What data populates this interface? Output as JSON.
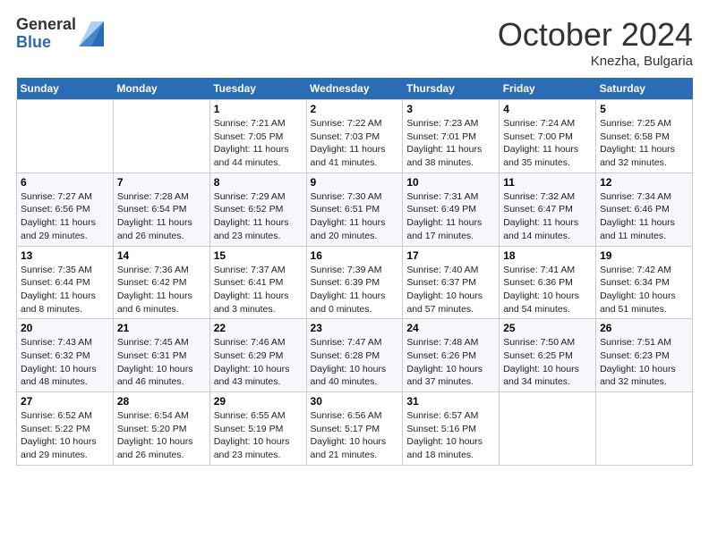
{
  "header": {
    "logo_general": "General",
    "logo_blue": "Blue",
    "month_title": "October 2024",
    "location": "Knezha, Bulgaria"
  },
  "weekdays": [
    "Sunday",
    "Monday",
    "Tuesday",
    "Wednesday",
    "Thursday",
    "Friday",
    "Saturday"
  ],
  "weeks": [
    [
      {
        "day": "",
        "sunrise": "",
        "sunset": "",
        "daylight": ""
      },
      {
        "day": "",
        "sunrise": "",
        "sunset": "",
        "daylight": ""
      },
      {
        "day": "1",
        "sunrise": "Sunrise: 7:21 AM",
        "sunset": "Sunset: 7:05 PM",
        "daylight": "Daylight: 11 hours and 44 minutes."
      },
      {
        "day": "2",
        "sunrise": "Sunrise: 7:22 AM",
        "sunset": "Sunset: 7:03 PM",
        "daylight": "Daylight: 11 hours and 41 minutes."
      },
      {
        "day": "3",
        "sunrise": "Sunrise: 7:23 AM",
        "sunset": "Sunset: 7:01 PM",
        "daylight": "Daylight: 11 hours and 38 minutes."
      },
      {
        "day": "4",
        "sunrise": "Sunrise: 7:24 AM",
        "sunset": "Sunset: 7:00 PM",
        "daylight": "Daylight: 11 hours and 35 minutes."
      },
      {
        "day": "5",
        "sunrise": "Sunrise: 7:25 AM",
        "sunset": "Sunset: 6:58 PM",
        "daylight": "Daylight: 11 hours and 32 minutes."
      }
    ],
    [
      {
        "day": "6",
        "sunrise": "Sunrise: 7:27 AM",
        "sunset": "Sunset: 6:56 PM",
        "daylight": "Daylight: 11 hours and 29 minutes."
      },
      {
        "day": "7",
        "sunrise": "Sunrise: 7:28 AM",
        "sunset": "Sunset: 6:54 PM",
        "daylight": "Daylight: 11 hours and 26 minutes."
      },
      {
        "day": "8",
        "sunrise": "Sunrise: 7:29 AM",
        "sunset": "Sunset: 6:52 PM",
        "daylight": "Daylight: 11 hours and 23 minutes."
      },
      {
        "day": "9",
        "sunrise": "Sunrise: 7:30 AM",
        "sunset": "Sunset: 6:51 PM",
        "daylight": "Daylight: 11 hours and 20 minutes."
      },
      {
        "day": "10",
        "sunrise": "Sunrise: 7:31 AM",
        "sunset": "Sunset: 6:49 PM",
        "daylight": "Daylight: 11 hours and 17 minutes."
      },
      {
        "day": "11",
        "sunrise": "Sunrise: 7:32 AM",
        "sunset": "Sunset: 6:47 PM",
        "daylight": "Daylight: 11 hours and 14 minutes."
      },
      {
        "day": "12",
        "sunrise": "Sunrise: 7:34 AM",
        "sunset": "Sunset: 6:46 PM",
        "daylight": "Daylight: 11 hours and 11 minutes."
      }
    ],
    [
      {
        "day": "13",
        "sunrise": "Sunrise: 7:35 AM",
        "sunset": "Sunset: 6:44 PM",
        "daylight": "Daylight: 11 hours and 8 minutes."
      },
      {
        "day": "14",
        "sunrise": "Sunrise: 7:36 AM",
        "sunset": "Sunset: 6:42 PM",
        "daylight": "Daylight: 11 hours and 6 minutes."
      },
      {
        "day": "15",
        "sunrise": "Sunrise: 7:37 AM",
        "sunset": "Sunset: 6:41 PM",
        "daylight": "Daylight: 11 hours and 3 minutes."
      },
      {
        "day": "16",
        "sunrise": "Sunrise: 7:39 AM",
        "sunset": "Sunset: 6:39 PM",
        "daylight": "Daylight: 11 hours and 0 minutes."
      },
      {
        "day": "17",
        "sunrise": "Sunrise: 7:40 AM",
        "sunset": "Sunset: 6:37 PM",
        "daylight": "Daylight: 10 hours and 57 minutes."
      },
      {
        "day": "18",
        "sunrise": "Sunrise: 7:41 AM",
        "sunset": "Sunset: 6:36 PM",
        "daylight": "Daylight: 10 hours and 54 minutes."
      },
      {
        "day": "19",
        "sunrise": "Sunrise: 7:42 AM",
        "sunset": "Sunset: 6:34 PM",
        "daylight": "Daylight: 10 hours and 51 minutes."
      }
    ],
    [
      {
        "day": "20",
        "sunrise": "Sunrise: 7:43 AM",
        "sunset": "Sunset: 6:32 PM",
        "daylight": "Daylight: 10 hours and 48 minutes."
      },
      {
        "day": "21",
        "sunrise": "Sunrise: 7:45 AM",
        "sunset": "Sunset: 6:31 PM",
        "daylight": "Daylight: 10 hours and 46 minutes."
      },
      {
        "day": "22",
        "sunrise": "Sunrise: 7:46 AM",
        "sunset": "Sunset: 6:29 PM",
        "daylight": "Daylight: 10 hours and 43 minutes."
      },
      {
        "day": "23",
        "sunrise": "Sunrise: 7:47 AM",
        "sunset": "Sunset: 6:28 PM",
        "daylight": "Daylight: 10 hours and 40 minutes."
      },
      {
        "day": "24",
        "sunrise": "Sunrise: 7:48 AM",
        "sunset": "Sunset: 6:26 PM",
        "daylight": "Daylight: 10 hours and 37 minutes."
      },
      {
        "day": "25",
        "sunrise": "Sunrise: 7:50 AM",
        "sunset": "Sunset: 6:25 PM",
        "daylight": "Daylight: 10 hours and 34 minutes."
      },
      {
        "day": "26",
        "sunrise": "Sunrise: 7:51 AM",
        "sunset": "Sunset: 6:23 PM",
        "daylight": "Daylight: 10 hours and 32 minutes."
      }
    ],
    [
      {
        "day": "27",
        "sunrise": "Sunrise: 6:52 AM",
        "sunset": "Sunset: 5:22 PM",
        "daylight": "Daylight: 10 hours and 29 minutes."
      },
      {
        "day": "28",
        "sunrise": "Sunrise: 6:54 AM",
        "sunset": "Sunset: 5:20 PM",
        "daylight": "Daylight: 10 hours and 26 minutes."
      },
      {
        "day": "29",
        "sunrise": "Sunrise: 6:55 AM",
        "sunset": "Sunset: 5:19 PM",
        "daylight": "Daylight: 10 hours and 23 minutes."
      },
      {
        "day": "30",
        "sunrise": "Sunrise: 6:56 AM",
        "sunset": "Sunset: 5:17 PM",
        "daylight": "Daylight: 10 hours and 21 minutes."
      },
      {
        "day": "31",
        "sunrise": "Sunrise: 6:57 AM",
        "sunset": "Sunset: 5:16 PM",
        "daylight": "Daylight: 10 hours and 18 minutes."
      },
      {
        "day": "",
        "sunrise": "",
        "sunset": "",
        "daylight": ""
      },
      {
        "day": "",
        "sunrise": "",
        "sunset": "",
        "daylight": ""
      }
    ]
  ]
}
